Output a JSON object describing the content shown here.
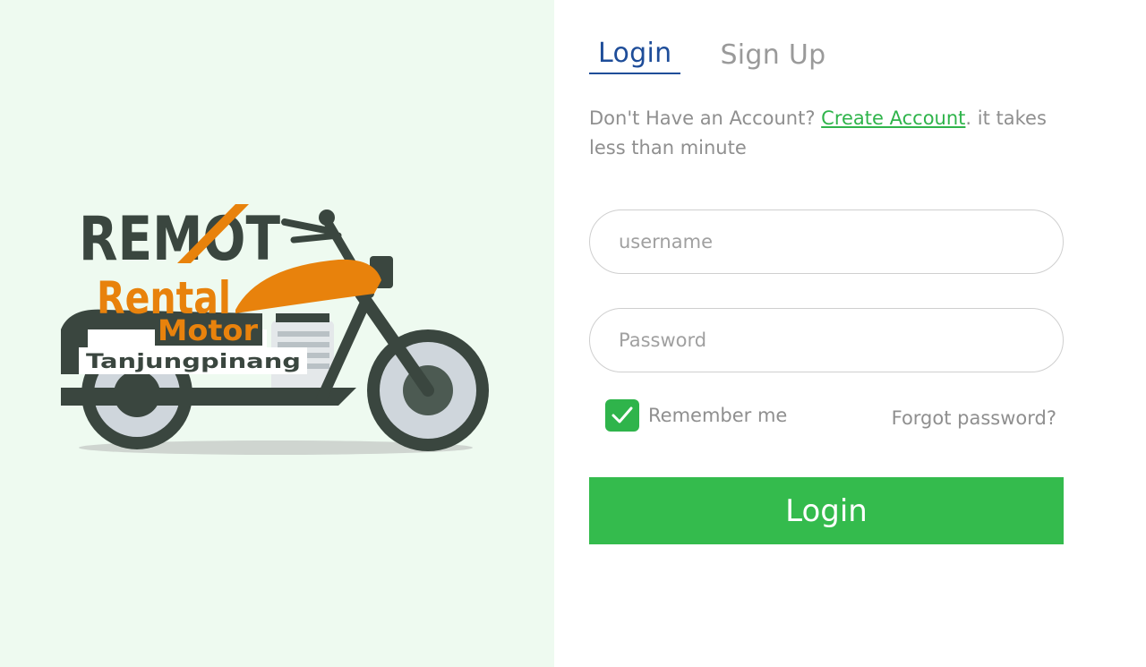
{
  "brand": {
    "logo_text_main": "REMOT",
    "logo_text_rental": "Rental",
    "logo_text_motor": "Motor",
    "logo_text_city": "Tanjungpinang",
    "accent_orange": "#e8820c",
    "dark_green": "#3a463f"
  },
  "tabs": [
    {
      "label": "Login",
      "active": true
    },
    {
      "label": "Sign Up",
      "active": false
    }
  ],
  "intro": {
    "prefix": "Don't Have an Account? ",
    "link_label": "Create Account",
    "suffix": ". it takes less than minute"
  },
  "form": {
    "username_placeholder": "username",
    "username_value": "",
    "password_placeholder": "Password",
    "password_value": "",
    "remember_label": "Remember me",
    "remember_checked": true,
    "forgot_label": "Forgot password?",
    "submit_label": "Login"
  },
  "colors": {
    "primary_green": "#34bb4d",
    "tab_active": "#1e4d99",
    "left_panel_bg": "#eefaf0"
  }
}
